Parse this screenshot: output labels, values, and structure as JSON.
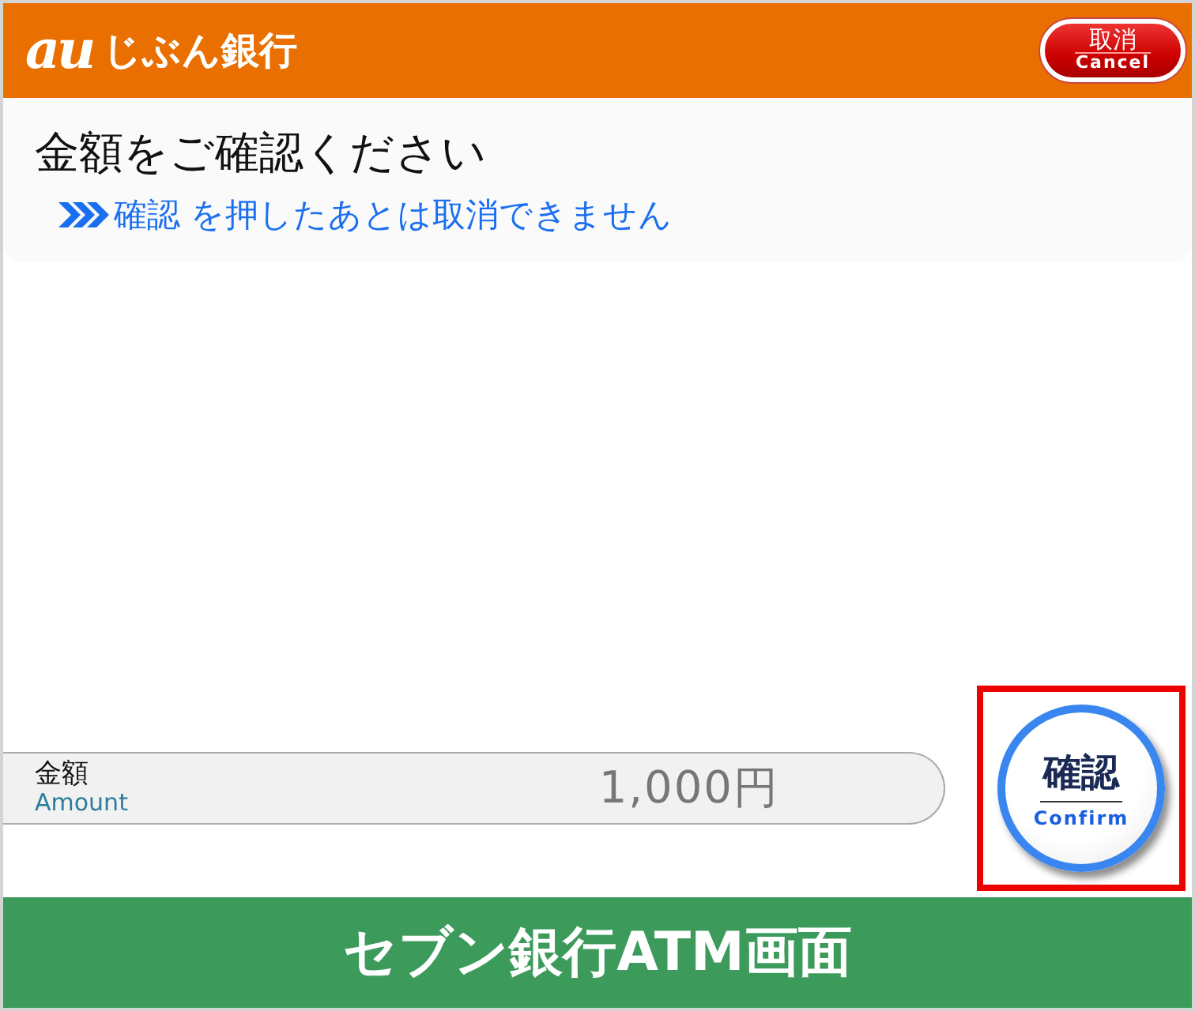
{
  "header": {
    "logo_mark": "au",
    "logo_text": "じぶん銀行",
    "cancel_button": {
      "label": "取消",
      "sublabel": "Cancel"
    }
  },
  "instruction": {
    "title": "金額をご確認ください",
    "hint": "確認 を押したあとは取消できません"
  },
  "amount": {
    "label": "金額",
    "sublabel": "Amount",
    "value": "1,000円"
  },
  "confirm_button": {
    "label": "確認",
    "sublabel": "Confirm",
    "highlighted": true
  },
  "footer": {
    "caption": "セブン銀行ATM画面"
  }
}
